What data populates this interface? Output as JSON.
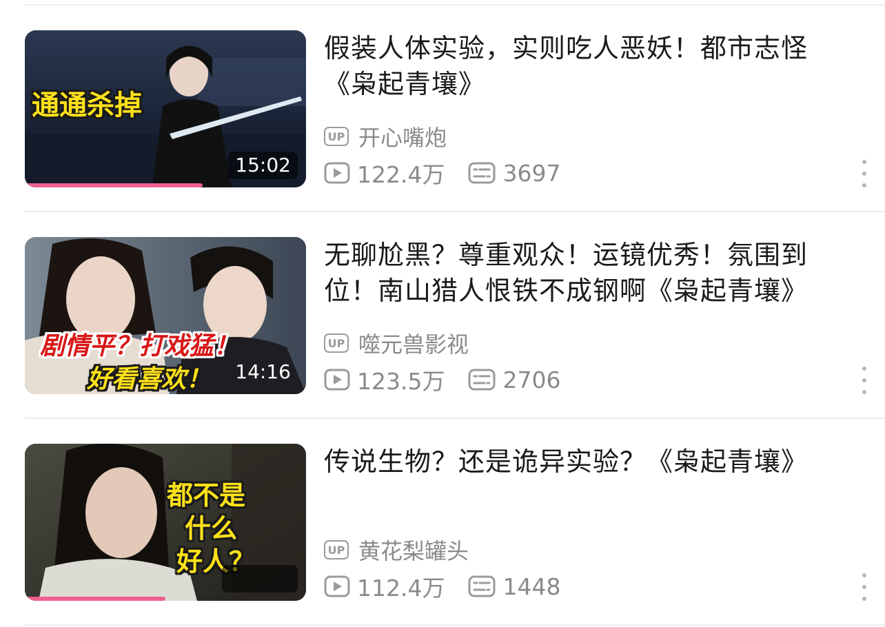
{
  "videos": [
    {
      "title": "假装人体实验，实则吃人恶妖！都市志怪《枭起青壤》",
      "thumbnail_caption": "通通杀掉",
      "duration": "15:02",
      "watch_progress": 0.63,
      "up_badge": "UP",
      "uploader": "开心嘴炮",
      "views": "122.4万",
      "danmaku": "3697"
    },
    {
      "title": "无聊尬黑？尊重观众！运镜优秀！氛围到位！南山猎人恨铁不成钢啊《枭起青壤》",
      "thumbnail_caption_line1": "剧情平？打戏猛！",
      "thumbnail_caption_line2": "好看喜欢！",
      "duration": "14:16",
      "up_badge": "UP",
      "uploader": "噬元兽影视",
      "views": "123.5万",
      "danmaku": "2706"
    },
    {
      "title": "传说生物？还是诡异实验？《枭起青壤》",
      "thumbnail_caption_line1": "都不是",
      "thumbnail_caption_line2": "什么",
      "thumbnail_caption_line3": "好人？",
      "watch_progress": 0.5,
      "up_badge": "UP",
      "uploader": "黄花梨罐头",
      "views": "112.4万",
      "danmaku": "1448"
    }
  ],
  "icons": {
    "play": "play-count-icon",
    "danmaku": "danmaku-count-icon",
    "more": "more-vertical-icon",
    "up": "uploader-badge-icon"
  },
  "colors": {
    "accent": "#f0608f",
    "meta_text": "#8a8a8a",
    "title_text": "#1a1a1a"
  }
}
